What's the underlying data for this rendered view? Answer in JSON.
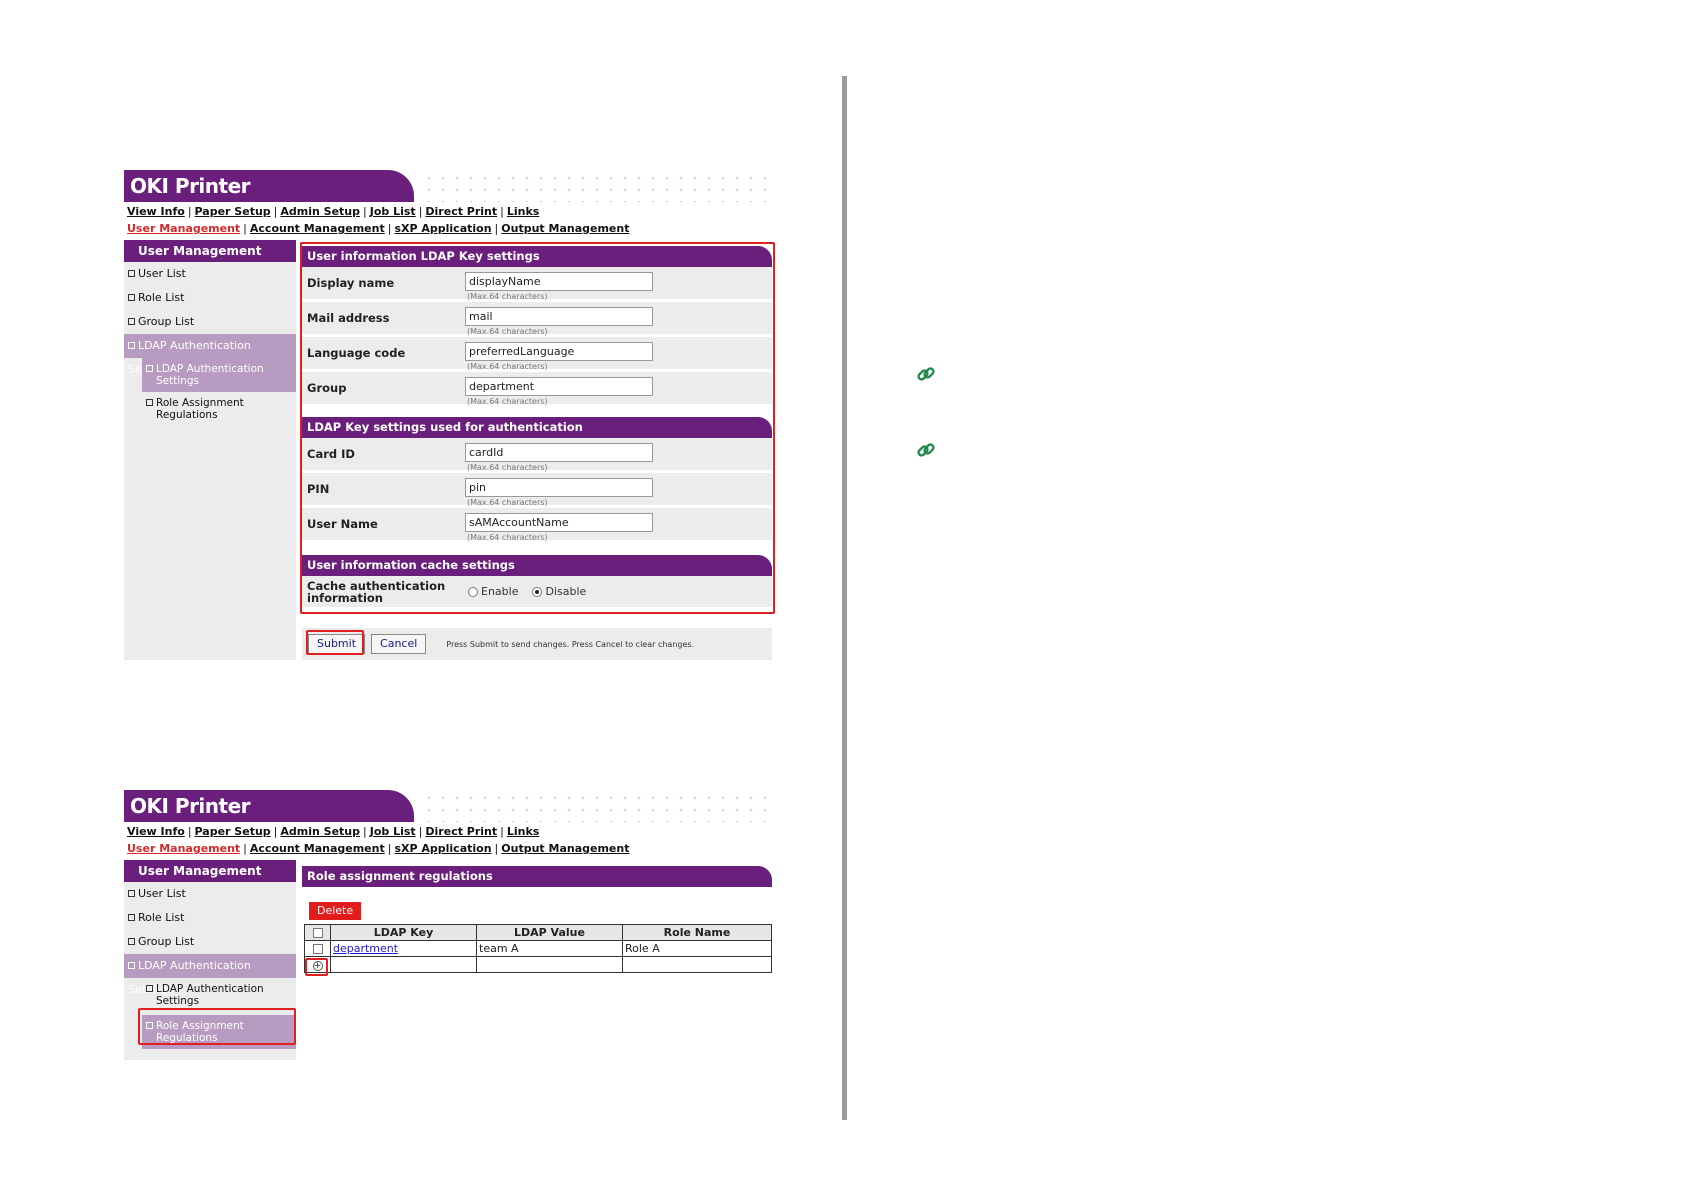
{
  "brand": "OKI Printer",
  "nav_row1": [
    "View Info",
    "Paper Setup",
    "Admin Setup",
    "Job List",
    "Direct Print",
    "Links"
  ],
  "nav_row2": [
    "User Management",
    "Account Management",
    "sXP Application",
    "Output Management"
  ],
  "sidebar": {
    "title": "User Management",
    "items": [
      "User List",
      "Role List",
      "Group List"
    ],
    "ldap_group": "LDAP Authentication Settings",
    "sub_items": [
      "LDAP Authentication Settings",
      "Role Assignment Regulations"
    ]
  },
  "screen1": {
    "section1": {
      "title": "User information LDAP Key settings",
      "fields": [
        {
          "label": "Display name",
          "value": "displayName",
          "hint": "(Max.64 characters)"
        },
        {
          "label": "Mail address",
          "value": "mail",
          "hint": "(Max.64 characters)"
        },
        {
          "label": "Language code",
          "value": "preferredLanguage",
          "hint": "(Max.64 characters)"
        },
        {
          "label": "Group",
          "value": "department",
          "hint": "(Max.64 characters)"
        }
      ]
    },
    "section2": {
      "title": "LDAP Key settings used for authentication",
      "fields": [
        {
          "label": "Card ID",
          "value": "cardId",
          "hint": "(Max.64 characters)"
        },
        {
          "label": "PIN",
          "value": "pin",
          "hint": "(Max.64 characters)"
        },
        {
          "label": "User Name",
          "value": "sAMAccountName",
          "hint": "(Max.64 characters)"
        }
      ]
    },
    "section3": {
      "title": "User information cache settings",
      "label": "Cache authentication information",
      "options": [
        "Enable",
        "Disable"
      ],
      "selected": "Disable"
    },
    "submit_label": "Submit",
    "cancel_label": "Cancel",
    "button_message": "Press Submit to send changes. Press Cancel to clear changes."
  },
  "screen2": {
    "title": "Role assignment regulations",
    "delete_label": "Delete",
    "columns": [
      "LDAP Key",
      "LDAP Value",
      "Role Name"
    ],
    "rows": [
      {
        "key": "department",
        "value": "team A",
        "role": "Role A"
      }
    ],
    "add_icon": "plus-circle-icon"
  },
  "icons": [
    "link-icon",
    "link-icon"
  ],
  "colors": {
    "brand_purple": "#6b1f7c",
    "highlight": "#e02020",
    "link_green": "#1f8a4c"
  }
}
